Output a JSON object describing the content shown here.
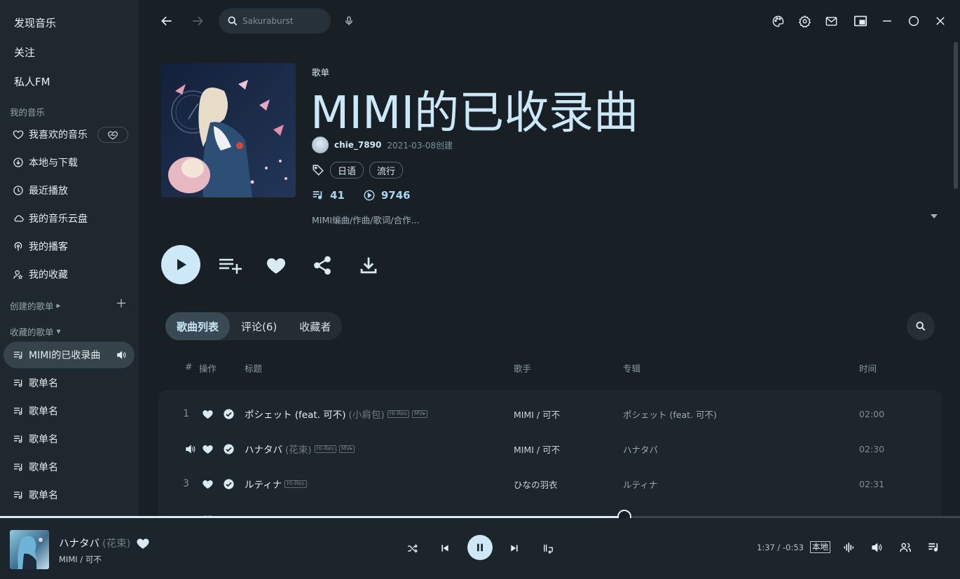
{
  "app": {
    "accent": "#cde8f7",
    "background": "#182026"
  },
  "sidebar": {
    "top_nav": [
      "发现音乐",
      "关注",
      "私人FM"
    ],
    "my_music_title": "我的音乐",
    "my_music": [
      {
        "label": "我喜欢的音乐",
        "icon": "heart-icon"
      },
      {
        "label": "本地与下载",
        "icon": "download-icon"
      },
      {
        "label": "最近播放",
        "icon": "clock-icon"
      },
      {
        "label": "我的音乐云盘",
        "icon": "cloud-icon"
      },
      {
        "label": "我的播客",
        "icon": "podcast-icon"
      },
      {
        "label": "我的收藏",
        "icon": "user-star-icon"
      }
    ],
    "created_title": "创建的歌单",
    "collected_title": "收藏的歌单",
    "playlists": [
      {
        "label": "MIMI的已收录曲",
        "active": true
      },
      {
        "label": "歌单名"
      },
      {
        "label": "歌单名"
      },
      {
        "label": "歌单名"
      },
      {
        "label": "歌单名"
      },
      {
        "label": "歌单名"
      }
    ]
  },
  "topbar": {
    "search_placeholder": "Sakuraburst"
  },
  "playlist": {
    "type_label": "歌单",
    "title": "MIMI的已收录曲",
    "creator": "chie_7890",
    "created": "2021-03-08创建",
    "tags": [
      "日语",
      "流行"
    ],
    "track_count": "41",
    "play_count": "9746",
    "description": "MIMI编曲/作曲/歌词/合作..."
  },
  "tabs": [
    {
      "label": "歌曲列表",
      "active": true
    },
    {
      "label": "评论(6)"
    },
    {
      "label": "收藏者"
    }
  ],
  "table": {
    "headers": {
      "num": "#",
      "ops": "操作",
      "title": "标题",
      "artist": "歌手",
      "album": "专辑",
      "duration": "时间"
    },
    "rows": [
      {
        "num": "1",
        "title": "ポシェット (feat. 可不)",
        "alias": "(小肩包)",
        "badges": [
          "Hi-Res",
          "MV▸"
        ],
        "artist": "MIMI / 可不",
        "album": "ポシェット (feat. 可不)",
        "duration": "02:00",
        "playing": false
      },
      {
        "num": "",
        "title": "ハナタバ",
        "alias": "(花束)",
        "badges": [
          "Hi-Res",
          "MV▸"
        ],
        "artist": "MIMI / 可不",
        "album": "ハナタバ",
        "duration": "02:30",
        "playing": true
      },
      {
        "num": "3",
        "title": "ルティナ",
        "alias": "",
        "badges": [
          "Hi-Res"
        ],
        "artist": "ひなの羽衣",
        "album": "ルティナ",
        "duration": "02:31",
        "playing": false
      }
    ]
  },
  "player": {
    "title": "ハナタバ",
    "alias": "(花束)",
    "artist": "MIMI / 可不",
    "time": "1:37 / -0:53",
    "source_badge": "本地",
    "progress": 0.65
  }
}
